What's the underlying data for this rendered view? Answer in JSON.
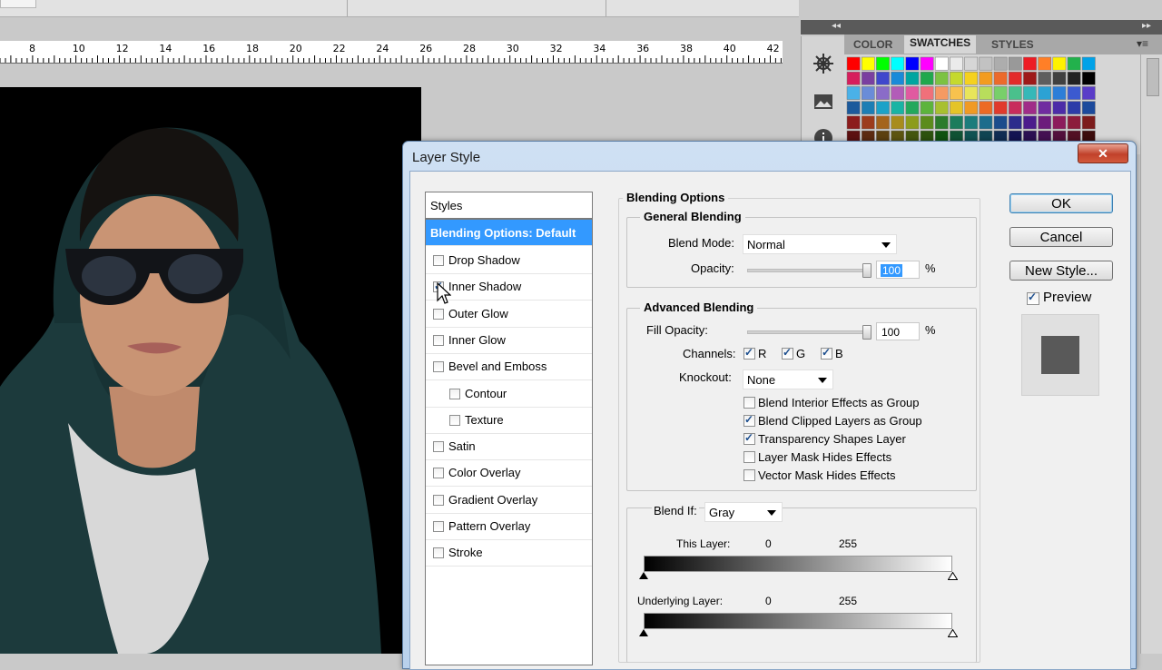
{
  "ruler": {
    "numbers": [
      "8",
      "10",
      "12",
      "14",
      "16",
      "18",
      "20",
      "22",
      "24",
      "26",
      "28",
      "30",
      "32",
      "34",
      "36",
      "38",
      "40",
      "42"
    ]
  },
  "panel": {
    "tabs": [
      "COLOR",
      "SWATCHES",
      "STYLES"
    ],
    "active_tab": "SWATCHES",
    "swatch_colors": [
      "#ff0000",
      "#ffff00",
      "#00ff00",
      "#00ffff",
      "#0000ff",
      "#ff00ff",
      "#ffffff",
      "#ebebeb",
      "#d6d6d6",
      "#c2c2c2",
      "#adadad",
      "#999999",
      "#ed1c24",
      "#ff7f27",
      "#fff200",
      "#22b14c",
      "#00a2e8"
    ]
  },
  "dialog": {
    "title": "Layer Style",
    "close_label": "✕",
    "styles_header": "Styles",
    "style_items": [
      {
        "label": "Blending Options: Default",
        "checkbox": false,
        "checked": false,
        "selected": true
      },
      {
        "label": "Drop Shadow",
        "checkbox": true,
        "checked": false
      },
      {
        "label": "Inner Shadow",
        "checkbox": true,
        "checked": true
      },
      {
        "label": "Outer Glow",
        "checkbox": true,
        "checked": false
      },
      {
        "label": "Inner Glow",
        "checkbox": true,
        "checked": false
      },
      {
        "label": "Bevel and Emboss",
        "checkbox": true,
        "checked": false
      },
      {
        "label": "Contour",
        "checkbox": true,
        "checked": false,
        "indent": true
      },
      {
        "label": "Texture",
        "checkbox": true,
        "checked": false,
        "indent": true
      },
      {
        "label": "Satin",
        "checkbox": true,
        "checked": false
      },
      {
        "label": "Color Overlay",
        "checkbox": true,
        "checked": false
      },
      {
        "label": "Gradient Overlay",
        "checkbox": true,
        "checked": false
      },
      {
        "label": "Pattern Overlay",
        "checkbox": true,
        "checked": false
      },
      {
        "label": "Stroke",
        "checkbox": true,
        "checked": false
      }
    ],
    "blending": {
      "section_title": "Blending Options",
      "general_title": "General Blending",
      "blend_mode_label": "Blend Mode:",
      "blend_mode_value": "Normal",
      "opacity_label": "Opacity:",
      "opacity_value": "100",
      "percent": "%",
      "advanced_title": "Advanced Blending",
      "fill_opacity_label": "Fill Opacity:",
      "fill_opacity_value": "100",
      "channels_label": "Channels:",
      "channels": [
        {
          "label": "R",
          "checked": true
        },
        {
          "label": "G",
          "checked": true
        },
        {
          "label": "B",
          "checked": true
        }
      ],
      "knockout_label": "Knockout:",
      "knockout_value": "None",
      "options": [
        {
          "label": "Blend Interior Effects as Group",
          "checked": false
        },
        {
          "label": "Blend Clipped Layers as Group",
          "checked": true
        },
        {
          "label": "Transparency Shapes Layer",
          "checked": true
        },
        {
          "label": "Layer Mask Hides Effects",
          "checked": false
        },
        {
          "label": "Vector Mask Hides Effects",
          "checked": false
        }
      ],
      "blend_if_label": "Blend If:",
      "blend_if_value": "Gray",
      "this_layer_label": "This Layer:",
      "this_layer_min": "0",
      "this_layer_max": "255",
      "underlying_label": "Underlying Layer:",
      "underlying_min": "0",
      "underlying_max": "255"
    },
    "buttons": {
      "ok": "OK",
      "cancel": "Cancel",
      "new_style": "New Style...",
      "preview_label": "Preview",
      "preview_checked": true
    }
  }
}
